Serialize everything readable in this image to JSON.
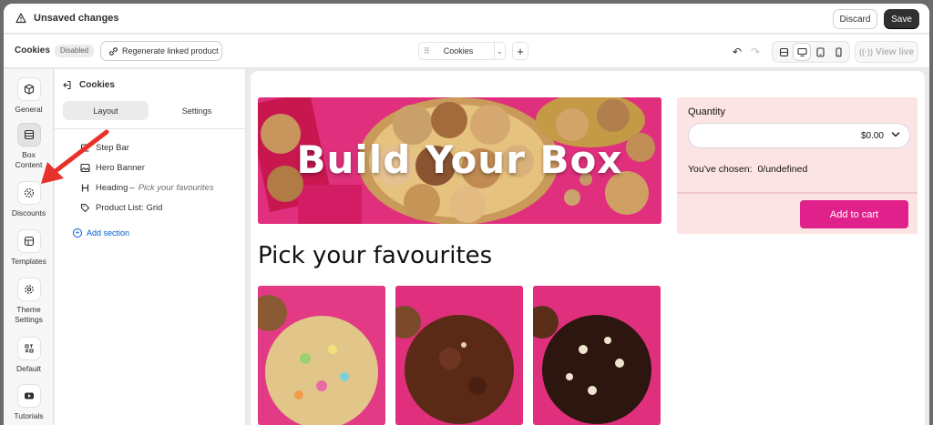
{
  "topbar": {
    "unsaved_text": "Unsaved changes",
    "discard_label": "Discard",
    "save_label": "Save"
  },
  "toolbar": {
    "title": "Cookies",
    "status_badge": "Disabled",
    "regenerate_label": "Regenerate linked product",
    "template_selected": "Cookies",
    "view_live_label": "View live"
  },
  "rail": {
    "items": [
      {
        "label": "General",
        "icon": "package-icon"
      },
      {
        "label": "Box Content",
        "icon": "box-content-icon"
      },
      {
        "label": "Discounts",
        "icon": "discount-icon"
      },
      {
        "label": "Templates",
        "icon": "templates-icon"
      },
      {
        "label": "Theme Settings",
        "icon": "gear-icon"
      },
      {
        "label": "Default",
        "icon": "layout-icon"
      },
      {
        "label": "Tutorials",
        "icon": "youtube-icon"
      }
    ]
  },
  "panel": {
    "title": "Cookies",
    "tabs": [
      {
        "label": "Layout"
      },
      {
        "label": "Settings"
      }
    ],
    "sections": [
      {
        "label": "Step Bar"
      },
      {
        "label": "Hero Banner"
      },
      {
        "label": "Heading",
        "sub": "Pick your favourites"
      },
      {
        "label": "Product List: Grid"
      }
    ],
    "add_section_label": "Add section",
    "heading_separator": "–"
  },
  "preview": {
    "hero_title": "Build Your Box",
    "section_title": "Pick your favourites",
    "quantity_label": "Quantity",
    "quantity_value": "$0.00",
    "chosen_label": "You've chosen:",
    "chosen_value": "0/undefined",
    "add_to_cart_label": "Add to cart"
  },
  "colors": {
    "accent": "#e0208b",
    "hero_bg": "#e0307d",
    "sidebox_bg": "#fde4e4",
    "link": "#005bd3",
    "annotation_arrow": "#e8312a"
  }
}
